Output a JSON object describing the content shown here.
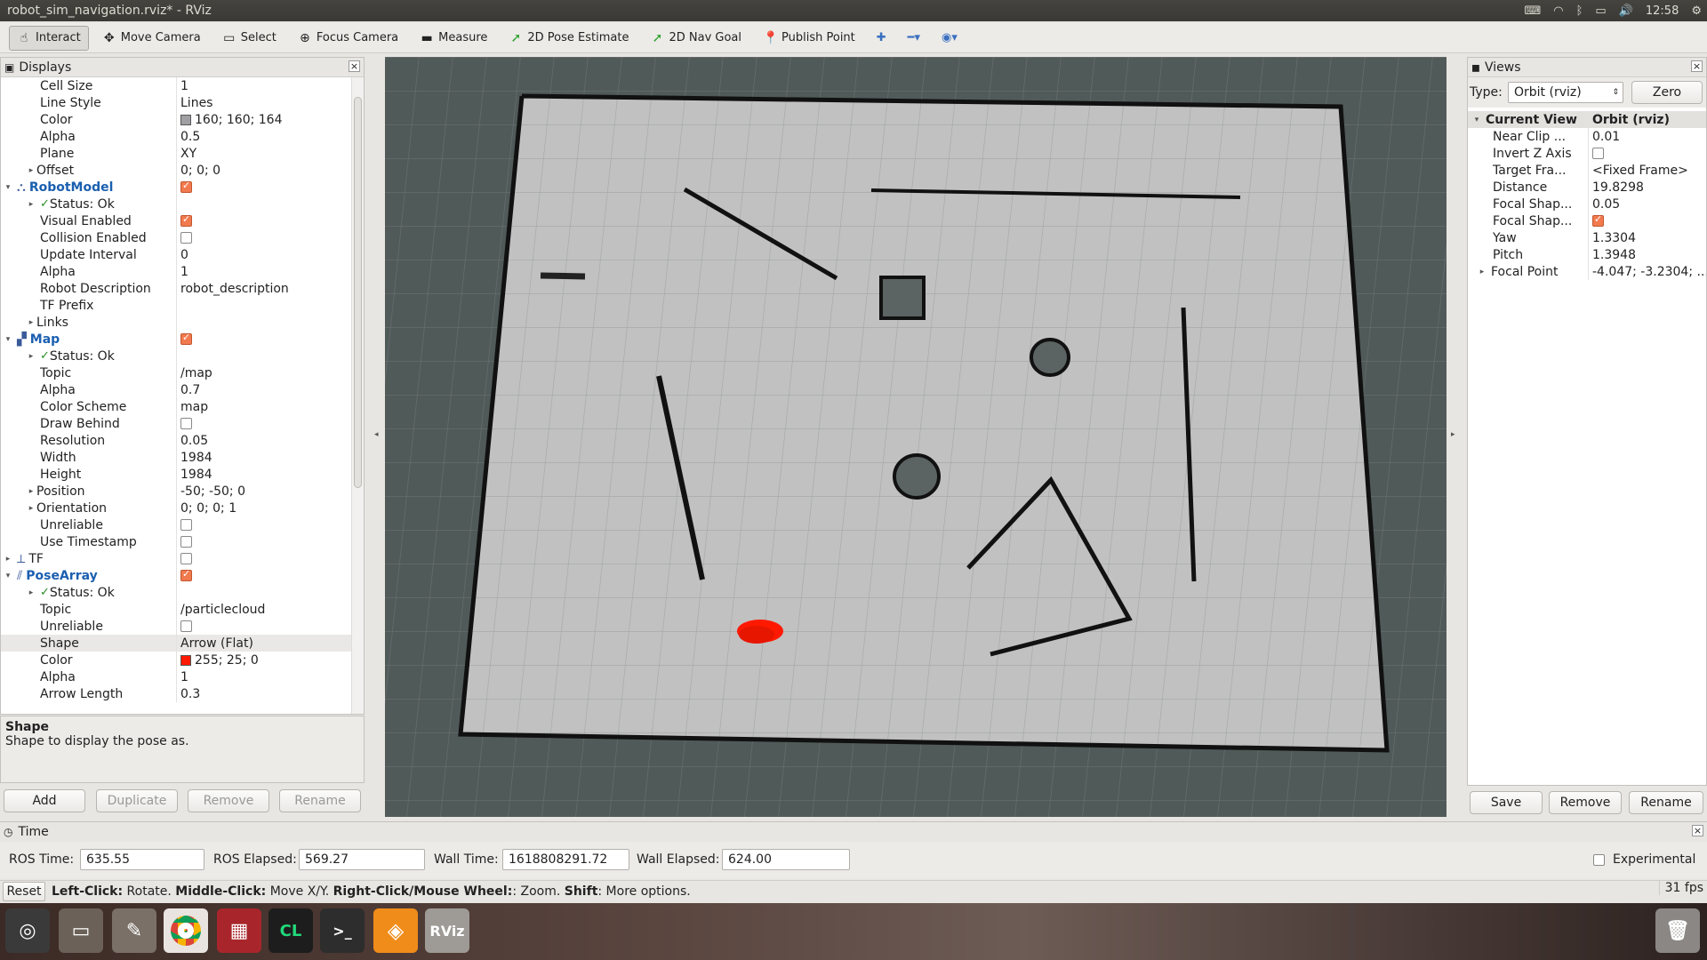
{
  "window": {
    "title": "robot_sim_navigation.rviz* - RViz",
    "clock": "12:58"
  },
  "toolbar": {
    "tools": [
      {
        "label": "Interact",
        "icon": "cursor-icon",
        "active": true
      },
      {
        "label": "Move Camera",
        "icon": "move-icon"
      },
      {
        "label": "Select",
        "icon": "select-icon"
      },
      {
        "label": "Focus Camera",
        "icon": "focus-icon"
      },
      {
        "label": "Measure",
        "icon": "ruler-icon"
      },
      {
        "label": "2D Pose Estimate",
        "icon": "green-arrow-icon"
      },
      {
        "label": "2D Nav Goal",
        "icon": "green-arrow-icon"
      },
      {
        "label": "Publish Point",
        "icon": "pin-icon"
      }
    ]
  },
  "displays": {
    "title": "Displays",
    "rows": [
      {
        "k": "Cell Size",
        "v": "1",
        "indent": 1
      },
      {
        "k": "Line Style",
        "v": "Lines",
        "indent": 1
      },
      {
        "k": "Color",
        "v": "160; 160; 164",
        "indent": 1,
        "swatch": "#a0a0a4"
      },
      {
        "k": "Alpha",
        "v": "0.5",
        "indent": 1
      },
      {
        "k": "Plane",
        "v": "XY",
        "indent": 1
      },
      {
        "k": "Offset",
        "v": "0; 0; 0",
        "indent": 1,
        "exp": "▸"
      },
      {
        "k": "RobotModel",
        "v": "",
        "indent": 0,
        "exp": "▾",
        "blue": true,
        "check": true,
        "icon": "robot-icon"
      },
      {
        "k": "Status: Ok",
        "v": "",
        "indent": 1,
        "exp": "▸",
        "ok": true
      },
      {
        "k": "Visual Enabled",
        "v": "",
        "indent": 1,
        "check": true
      },
      {
        "k": "Collision Enabled",
        "v": "",
        "indent": 1,
        "check": false
      },
      {
        "k": "Update Interval",
        "v": "0",
        "indent": 1
      },
      {
        "k": "Alpha",
        "v": "1",
        "indent": 1
      },
      {
        "k": "Robot Description",
        "v": "robot_description",
        "indent": 1
      },
      {
        "k": "TF Prefix",
        "v": "",
        "indent": 1
      },
      {
        "k": "Links",
        "v": "",
        "indent": 1,
        "exp": "▸"
      },
      {
        "k": "Map",
        "v": "",
        "indent": 0,
        "exp": "▾",
        "blue": true,
        "check": true,
        "icon": "map-icon"
      },
      {
        "k": "Status: Ok",
        "v": "",
        "indent": 1,
        "exp": "▸",
        "ok": true
      },
      {
        "k": "Topic",
        "v": "/map",
        "indent": 1
      },
      {
        "k": "Alpha",
        "v": "0.7",
        "indent": 1
      },
      {
        "k": "Color Scheme",
        "v": "map",
        "indent": 1
      },
      {
        "k": "Draw Behind",
        "v": "",
        "indent": 1,
        "check": false
      },
      {
        "k": "Resolution",
        "v": "0.05",
        "indent": 1
      },
      {
        "k": "Width",
        "v": "1984",
        "indent": 1
      },
      {
        "k": "Height",
        "v": "1984",
        "indent": 1
      },
      {
        "k": "Position",
        "v": "-50; -50; 0",
        "indent": 1,
        "exp": "▸"
      },
      {
        "k": "Orientation",
        "v": "0; 0; 0; 1",
        "indent": 1,
        "exp": "▸"
      },
      {
        "k": "Unreliable",
        "v": "",
        "indent": 1,
        "check": false
      },
      {
        "k": "Use Timestamp",
        "v": "",
        "indent": 1,
        "check": false
      },
      {
        "k": "TF",
        "v": "",
        "indent": 0,
        "exp": "▸",
        "check": false,
        "icon": "tf-icon"
      },
      {
        "k": "PoseArray",
        "v": "",
        "indent": 0,
        "exp": "▾",
        "blue": true,
        "check": true,
        "icon": "posearray-icon"
      },
      {
        "k": "Status: Ok",
        "v": "",
        "indent": 1,
        "exp": "▸",
        "ok": true
      },
      {
        "k": "Topic",
        "v": "/particlecloud",
        "indent": 1
      },
      {
        "k": "Unreliable",
        "v": "",
        "indent": 1,
        "check": false
      },
      {
        "k": "Shape",
        "v": "Arrow (Flat)",
        "indent": 1,
        "hl": true
      },
      {
        "k": "Color",
        "v": "255; 25; 0",
        "indent": 1,
        "swatch": "#ff1900"
      },
      {
        "k": "Alpha",
        "v": "1",
        "indent": 1
      },
      {
        "k": "Arrow Length",
        "v": "0.3",
        "indent": 1
      }
    ],
    "desc_title": "Shape",
    "desc_text": "Shape to display the pose as.",
    "buttons": {
      "add": "Add",
      "duplicate": "Duplicate",
      "remove": "Remove",
      "rename": "Rename"
    }
  },
  "views": {
    "title": "Views",
    "type_label": "Type:",
    "type_value": "Orbit (rviz)",
    "zero": "Zero",
    "header": {
      "k": "Current View",
      "v": "Orbit (rviz)"
    },
    "rows": [
      {
        "k": "Near Clip ...",
        "v": "0.01"
      },
      {
        "k": "Invert Z Axis",
        "v": "",
        "check": false
      },
      {
        "k": "Target Fra...",
        "v": "<Fixed Frame>"
      },
      {
        "k": "Distance",
        "v": "19.8298"
      },
      {
        "k": "Focal Shap...",
        "v": "0.05"
      },
      {
        "k": "Focal Shap...",
        "v": "",
        "check": true
      },
      {
        "k": "Yaw",
        "v": "1.3304"
      },
      {
        "k": "Pitch",
        "v": "1.3948"
      },
      {
        "k": "Focal Point",
        "v": "-4.047; -3.2304; ...",
        "exp": "▸"
      }
    ],
    "buttons": {
      "save": "Save",
      "remove": "Remove",
      "rename": "Rename"
    }
  },
  "time": {
    "title": "Time",
    "ros_time_label": "ROS Time:",
    "ros_time": "635.55",
    "ros_elapsed_label": "ROS Elapsed:",
    "ros_elapsed": "569.27",
    "wall_time_label": "Wall Time:",
    "wall_time": "1618808291.72",
    "wall_elapsed_label": "Wall Elapsed:",
    "wall_elapsed": "624.00",
    "experimental": "Experimental"
  },
  "status": {
    "reset": "Reset",
    "hint_b1": "Left-Click:",
    "hint_t1": " Rotate. ",
    "hint_b2": "Middle-Click:",
    "hint_t2": " Move X/Y. ",
    "hint_b3": "Right-Click/Mouse Wheel:",
    "hint_t3": ": Zoom. ",
    "hint_b4": "Shift",
    "hint_t4": ": More options.",
    "fps": "31 fps"
  },
  "dock": {
    "rviz_label": "RViz",
    "clion_label": "CL"
  }
}
